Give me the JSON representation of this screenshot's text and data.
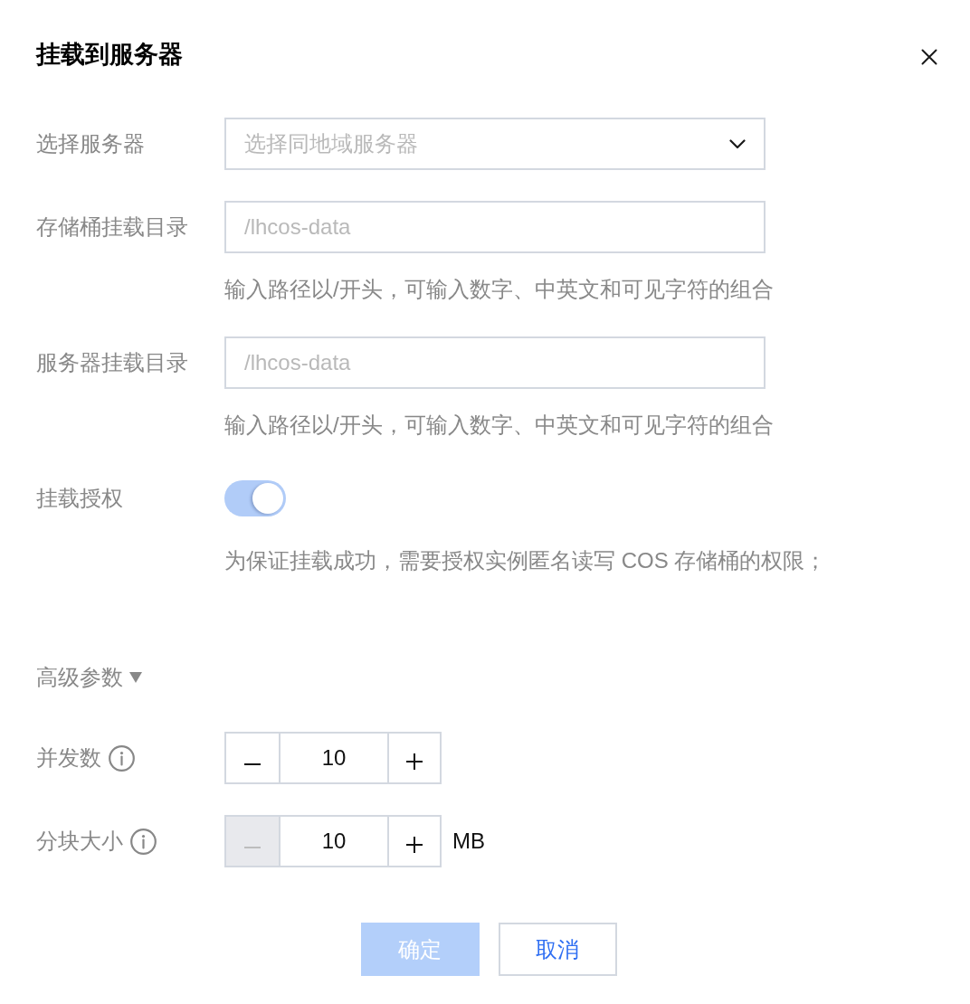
{
  "dialog": {
    "title": "挂载到服务器"
  },
  "fields": [
    {
      "kind": "select",
      "label": "选择服务器",
      "placeholder": "选择同地域服务器"
    },
    {
      "kind": "input",
      "label": "存储桶挂载目录",
      "placeholder": "/lhcos-data",
      "help": "输入路径以/开头，可输入数字、中英文和可见字符的组合"
    },
    {
      "kind": "input",
      "label": "服务器挂载目录",
      "placeholder": "/lhcos-data",
      "help": "输入路径以/开头，可输入数字、中英文和可见字符的组合"
    },
    {
      "kind": "toggle",
      "label": "挂载授权",
      "on": true,
      "disabled": true,
      "help": "为保证挂载成功，需要授权实例匿名读写 COS 存储桶的权限；"
    }
  ],
  "advanced": {
    "label": "高级参数",
    "expanded": true
  },
  "params": [
    {
      "kind": "stepper",
      "label": "并发数",
      "value": "10",
      "minus_disabled": false
    },
    {
      "kind": "stepper",
      "label": "分块大小",
      "value": "10",
      "unit": "MB",
      "minus_disabled": true
    }
  ],
  "actions": [
    {
      "kind": "primary",
      "label": "确定",
      "disabled": true
    },
    {
      "kind": "secondary",
      "label": "取消",
      "disabled": false
    }
  ]
}
